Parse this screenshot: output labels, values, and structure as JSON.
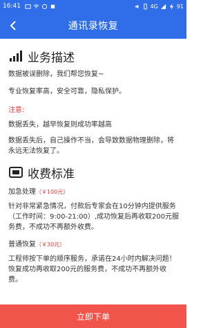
{
  "status_bar": {
    "time": "16:41",
    "network": "4G",
    "battery": "91"
  },
  "header": {
    "title": "通讯录恢复",
    "back_icon": "chevron-left-icon"
  },
  "sections": {
    "business": {
      "icon": "signal-bars-icon",
      "title": "业务描述",
      "line1": "数据被误删除，我们帮您恢复~",
      "line2": "专业恢复率高，安全可靠，隐私保护。",
      "note_label": "注意:",
      "note1": "数据丢失，越早恢复则成功率越高",
      "note2": "数据丢失后，自己操作不当，会导致数据物理删除，将永远无法恢复了。"
    },
    "pricing": {
      "icon": "billing-icon",
      "title": "收费标准",
      "urgent_label": "加急处理",
      "urgent_price": "（￥100元）",
      "urgent_desc": "针对非常紧急情况，付款后专家会在10分钟内提供服务（工作时间：9:00-21:00）,成功恢复后再收取200元服务费，不成功不再额外收费。",
      "normal_label": "普通恢复",
      "normal_price": "（￥30元）",
      "normal_desc": "工程师按下单的顺序服务，承诺在24小时内解决问题！恢复成功再收取200元的服务费，不成功不再额外收费。"
    }
  },
  "footer": {
    "button_label": "立即下单"
  },
  "colors": {
    "primary": "#2f6ee8",
    "accent_red": "#e53935",
    "button": "#f0544a"
  }
}
